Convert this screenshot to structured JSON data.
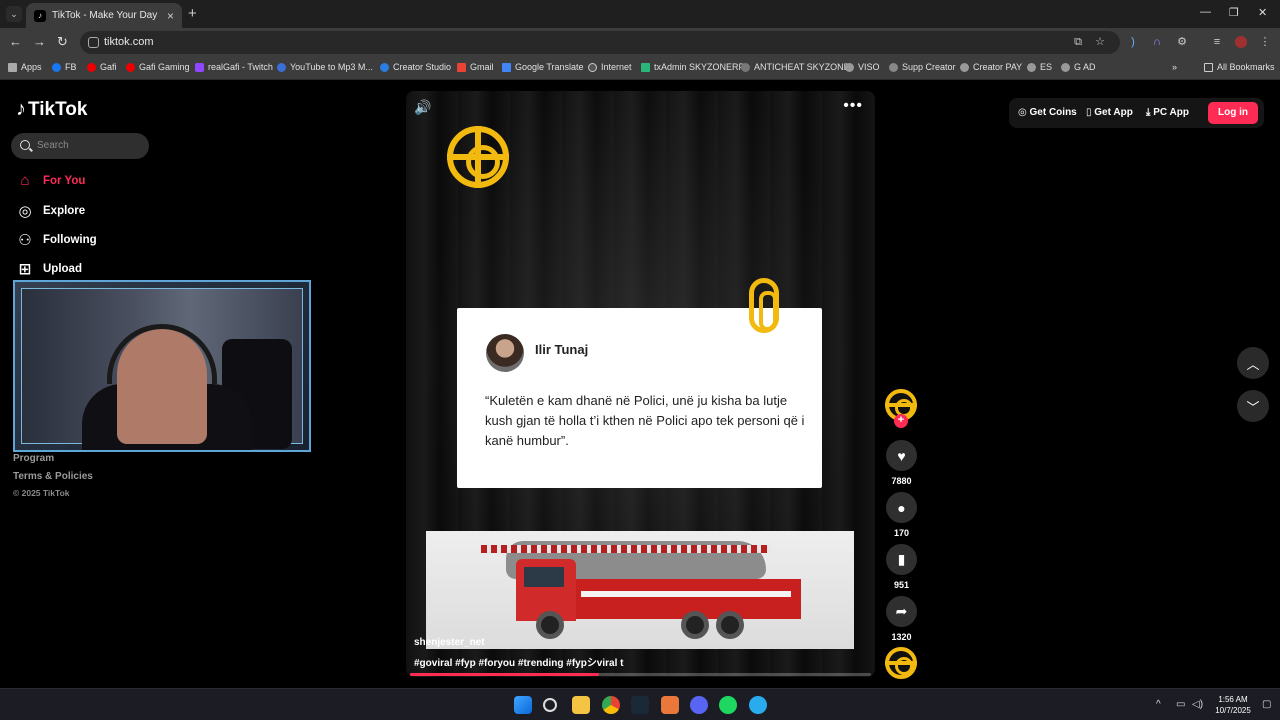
{
  "browser": {
    "tab_title": "TikTok - Make Your Day",
    "url": "tiktok.com",
    "bookmarks": [
      "Apps",
      "FB",
      "Gafi",
      "Gafi Gaming",
      "realGafi - Twitch",
      "YouTube to Mp3 M...",
      "Creator Studio",
      "Gmail",
      "Google Translate",
      "Internet",
      "txAdmin SKYZONERP",
      "ANTICHEAT SKYZONE",
      "VISO",
      "Supp Creator",
      "Creator PAY",
      "ES",
      "G AD"
    ],
    "all_bookmarks": "All Bookmarks"
  },
  "tiktok": {
    "logo_text": "TikTok",
    "search_placeholder": "Search",
    "nav": {
      "for_you": "For You",
      "explore": "Explore",
      "following": "Following",
      "upload": "Upload"
    },
    "footer": {
      "program": "Program",
      "terms": "Terms & Policies",
      "copyright": "© 2025 TikTok"
    },
    "topbar": {
      "get_coins": "Get Coins",
      "get_app": "Get App",
      "pc_app": "PC App",
      "login": "Log in"
    }
  },
  "video": {
    "author": "shenjester_net",
    "caption": "#goviral #fyp #foryou #trending #fypシviral  t",
    "progress_percent": 41,
    "quote_card": {
      "name": "Ilir Tunaj",
      "quote": "“Kuletën e kam dhanë në Polici, unë ju kisha ba lutje kush gjan të holla t’i kthen në Polici apo tek personi që i kanë humbur”."
    },
    "stats": {
      "likes": "7880",
      "comments": "170",
      "saves": "951",
      "shares": "1320"
    }
  },
  "taskbar": {
    "time": "1:56 AM",
    "date": "10/7/2025"
  },
  "colors": {
    "accent": "#fe2c55",
    "brand_yellow": "#f2b90f"
  }
}
